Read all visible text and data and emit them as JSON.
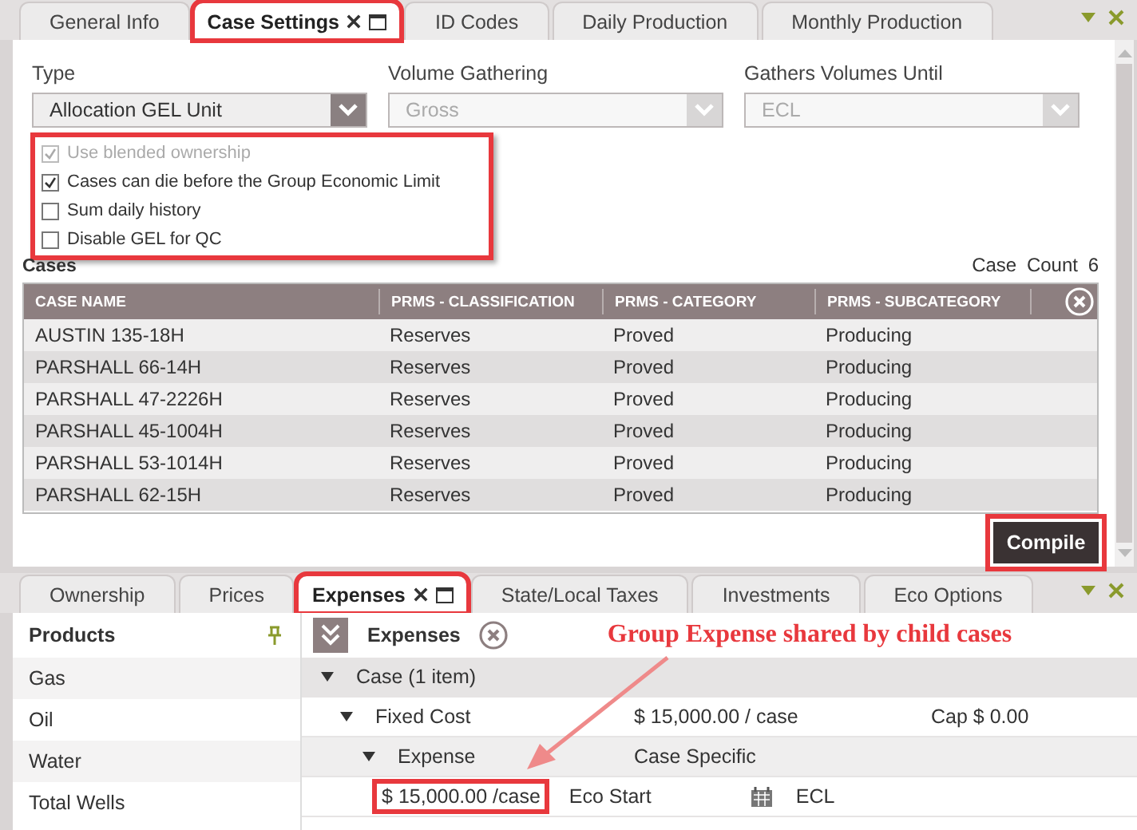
{
  "top_tabs": [
    {
      "label": "General Info",
      "selected": false,
      "highlighted": false
    },
    {
      "label": "Case Settings",
      "selected": true,
      "highlighted": true
    },
    {
      "label": "ID Codes",
      "selected": false,
      "highlighted": false
    },
    {
      "label": "Daily Production",
      "selected": false,
      "highlighted": false
    },
    {
      "label": "Monthly Production",
      "selected": false,
      "highlighted": false
    }
  ],
  "fields": [
    {
      "label": "Type",
      "value": "Allocation GEL Unit",
      "disabled": false
    },
    {
      "label": "Volume Gathering",
      "value": "Gross",
      "disabled": true
    },
    {
      "label": "Gathers Volumes Until",
      "value": "ECL",
      "disabled": true
    }
  ],
  "options": [
    {
      "label": "Use blended ownership",
      "checked": true,
      "disabled": true
    },
    {
      "label": "Cases can die before the Group Economic Limit",
      "checked": true,
      "disabled": false
    },
    {
      "label": "Sum daily history",
      "checked": false,
      "disabled": false
    },
    {
      "label": "Disable GEL for QC",
      "checked": false,
      "disabled": false
    }
  ],
  "cases": {
    "title": "Cases",
    "count_label": "Case Count",
    "count": "6",
    "columns": [
      "CASE NAME",
      "PRMS - CLASSIFICATION",
      "PRMS - CATEGORY",
      "PRMS - SUBCATEGORY"
    ],
    "rows": [
      [
        "AUSTIN 135-18H",
        "Reserves",
        "Proved",
        "Producing"
      ],
      [
        "PARSHALL 66-14H",
        "Reserves",
        "Proved",
        "Producing"
      ],
      [
        "PARSHALL 47-2226H",
        "Reserves",
        "Proved",
        "Producing"
      ],
      [
        "PARSHALL 45-1004H",
        "Reserves",
        "Proved",
        "Producing"
      ],
      [
        "PARSHALL 53-1014H",
        "Reserves",
        "Proved",
        "Producing"
      ],
      [
        "PARSHALL 62-15H",
        "Reserves",
        "Proved",
        "Producing"
      ]
    ]
  },
  "compile_button": "Compile",
  "bottom_tabs": [
    {
      "label": "Ownership",
      "selected": false,
      "highlighted": false
    },
    {
      "label": "Prices",
      "selected": false,
      "highlighted": false
    },
    {
      "label": "Expenses",
      "selected": true,
      "highlighted": true
    },
    {
      "label": "State/Local Taxes",
      "selected": false,
      "highlighted": false
    },
    {
      "label": "Investments",
      "selected": false,
      "highlighted": false
    },
    {
      "label": "Eco Options",
      "selected": false,
      "highlighted": false
    }
  ],
  "products": {
    "title": "Products",
    "items": [
      "Gas",
      "Oil",
      "Water",
      "Total Wells"
    ]
  },
  "expenses": {
    "title": "Expenses",
    "group": "Case (1 item)",
    "fixed_cost": {
      "label": "Fixed Cost",
      "amount": "$ 15,000.00 / case",
      "cap_label": "Cap",
      "cap": "$ 0.00"
    },
    "expense": {
      "label": "Expense",
      "type": "Case Specific"
    },
    "entry": {
      "currency": "$",
      "amount": "15,000.00 /case",
      "start": "Eco Start",
      "end": "ECL"
    }
  },
  "annotation": "Group Expense shared by child cases"
}
